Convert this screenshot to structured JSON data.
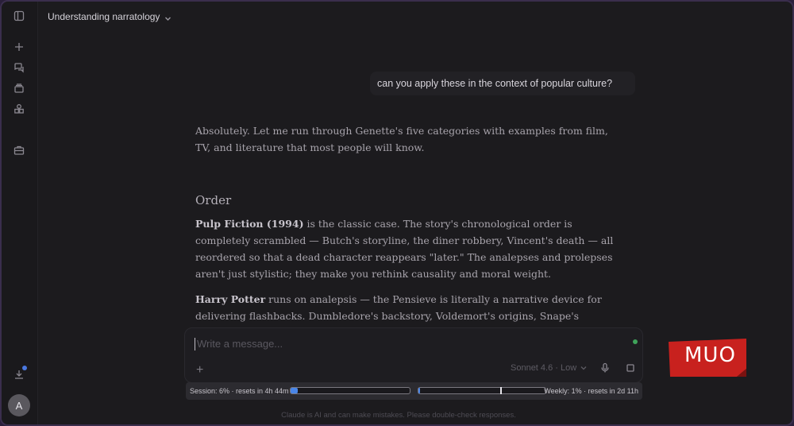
{
  "header": {
    "conversation_title": "Understanding narratology"
  },
  "user_message": "can you apply these in the context of popular culture?",
  "response": {
    "intro": "Absolutely. Let me run through Genette's five categories with examples from film, TV, and literature that most people will know.",
    "heading": "Order",
    "p1_bold": "Pulp Fiction (1994)",
    "p1_text": " is the classic case. The story's chronological order is completely scrambled — Butch's storyline, the diner robbery, Vincent's death — all reordered so that a dead character reappears \"later.\" The analepses and prolepses aren't just stylistic; they make you rethink causality and moral weight.",
    "p2_bold": "Harry Potter",
    "p2_text": " runs on analepsis — the Pensieve is literally a narrative device for delivering flashbacks. Dumbledore's backstory, Voldemort's origins, Snape's memories in the final"
  },
  "composer": {
    "placeholder": "Write a message...",
    "model_label": "Sonnet 4.6 · Low"
  },
  "usage": {
    "session_text": "Session: 6% · resets in 4h 44m",
    "session_percent": 6,
    "weekly_text": "Weekly: 1% · resets in 2d 11h",
    "weekly_percent": 1
  },
  "footer": {
    "disclaimer": "Claude is AI and can make mistakes. Please double-check responses."
  },
  "avatar": {
    "initial": "A"
  },
  "watermark": {
    "text": "MUO"
  },
  "colors": {
    "accent_blue": "#4a86e8",
    "status_green": "#3fa35a",
    "watermark_red": "#c8211e"
  }
}
